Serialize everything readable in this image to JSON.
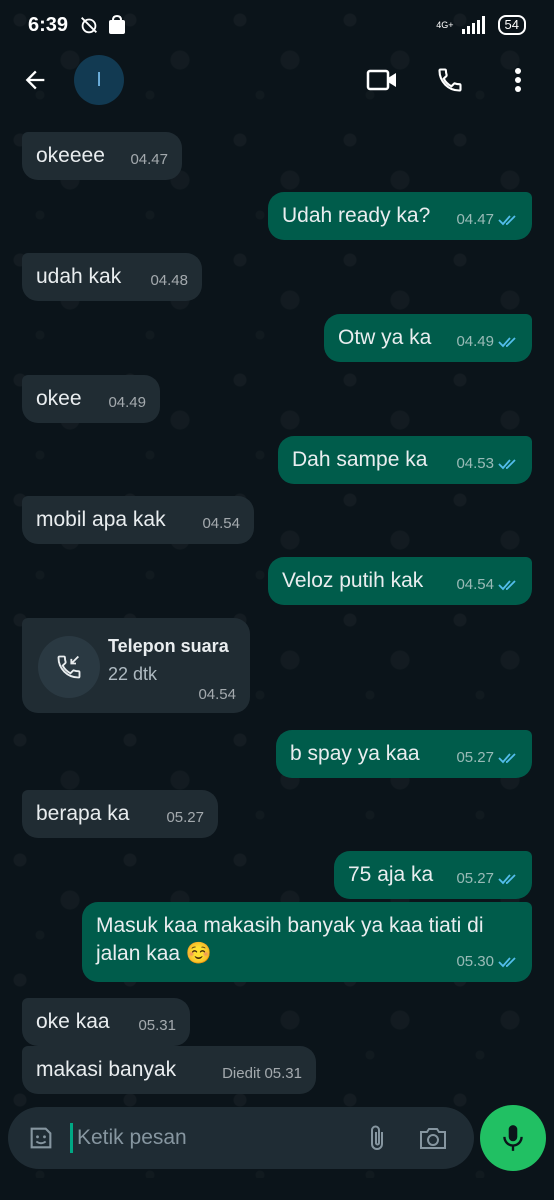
{
  "status_bar": {
    "time": "6:39",
    "network": "4G+",
    "battery": "54"
  },
  "header": {
    "avatar_initial": "I"
  },
  "messages": [
    {
      "dir": "in",
      "text": "okeeee",
      "time": "04.47"
    },
    {
      "dir": "out",
      "text": "Udah ready ka?",
      "time": "04.47"
    },
    {
      "dir": "in",
      "text": "udah kak",
      "time": "04.48"
    },
    {
      "dir": "out",
      "text": "Otw ya ka",
      "time": "04.49"
    },
    {
      "dir": "in",
      "text": "okee",
      "time": "04.49"
    },
    {
      "dir": "out",
      "text": "Dah sampe ka",
      "time": "04.53"
    },
    {
      "dir": "in",
      "text": "mobil apa kak",
      "time": "04.54"
    },
    {
      "dir": "out",
      "text": "Veloz putih kak",
      "time": "04.54"
    },
    {
      "dir": "out",
      "text": "b spay ya kaa",
      "time": "05.27"
    },
    {
      "dir": "in",
      "text": "berapa ka",
      "time": "05.27"
    },
    {
      "dir": "out",
      "text": "75 aja ka",
      "time": "05.27"
    },
    {
      "dir": "out",
      "text_line1": "Masuk kaa makasih banyak ya kaa tiati di",
      "text_line2": "jalan kaa ☺️",
      "time": "05.30"
    },
    {
      "dir": "in",
      "text": "oke kaa",
      "time": "05.31"
    },
    {
      "dir": "in",
      "text": "makasi banyak",
      "edited": "Diedit",
      "time": "05.31"
    }
  ],
  "call": {
    "title": "Telepon suara",
    "duration": "22 dtk",
    "time": "04.54"
  },
  "input": {
    "placeholder": "Ketik pesan"
  },
  "colors": {
    "background": "#0b141a",
    "incoming": "#202c33",
    "outgoing": "#005c4b",
    "accent": "#21c063",
    "read_ticks": "#53bdeb"
  },
  "icons": [
    "back-arrow-icon",
    "video-call-icon",
    "phone-icon",
    "more-vert-icon",
    "incoming-call-icon",
    "sticker-icon",
    "attach-icon",
    "camera-icon",
    "mic-icon"
  ]
}
